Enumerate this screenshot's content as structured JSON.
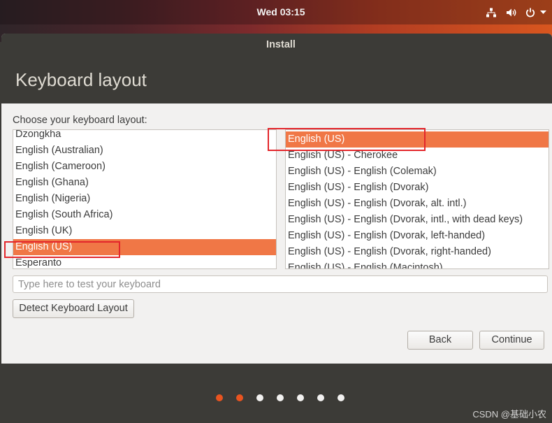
{
  "topbar": {
    "clock": "Wed 03:15",
    "tray_icons": {
      "network": "network-icon",
      "volume": "volume-icon",
      "power": "power-icon",
      "menu": "chevron-down-icon"
    }
  },
  "window": {
    "title": "Install"
  },
  "page": {
    "title": "Keyboard layout",
    "prompt": "Choose your keyboard layout:"
  },
  "layouts": {
    "items": [
      {
        "label": "Dzongkha",
        "selected": false
      },
      {
        "label": "English (Australian)",
        "selected": false
      },
      {
        "label": "English (Cameroon)",
        "selected": false
      },
      {
        "label": "English (Ghana)",
        "selected": false
      },
      {
        "label": "English (Nigeria)",
        "selected": false
      },
      {
        "label": "English (South Africa)",
        "selected": false
      },
      {
        "label": "English (UK)",
        "selected": false
      },
      {
        "label": "English (US)",
        "selected": true
      },
      {
        "label": "Esperanto",
        "selected": false
      }
    ]
  },
  "variants": {
    "items": [
      {
        "label": "English (US)",
        "selected": true
      },
      {
        "label": "English (US) - Cherokee",
        "selected": false
      },
      {
        "label": "English (US) - English (Colemak)",
        "selected": false
      },
      {
        "label": "English (US) - English (Dvorak)",
        "selected": false
      },
      {
        "label": "English (US) - English (Dvorak, alt. intl.)",
        "selected": false
      },
      {
        "label": "English (US) - English (Dvorak, intl., with dead keys)",
        "selected": false
      },
      {
        "label": "English (US) - English (Dvorak, left-handed)",
        "selected": false
      },
      {
        "label": "English (US) - English (Dvorak, right-handed)",
        "selected": false
      },
      {
        "label": "English (US) - English (Macintosh)",
        "selected": false
      }
    ]
  },
  "test_input": {
    "placeholder": "Type here to test your keyboard",
    "value": ""
  },
  "buttons": {
    "detect": "Detect Keyboard Layout",
    "back": "Back",
    "continue": "Continue"
  },
  "progress": {
    "total_steps": 7,
    "completed_steps": 2
  },
  "watermark": "CSDN @基础小农",
  "colors": {
    "accent": "#e95420",
    "selection": "#f07746",
    "annotation": "#e3262b"
  }
}
